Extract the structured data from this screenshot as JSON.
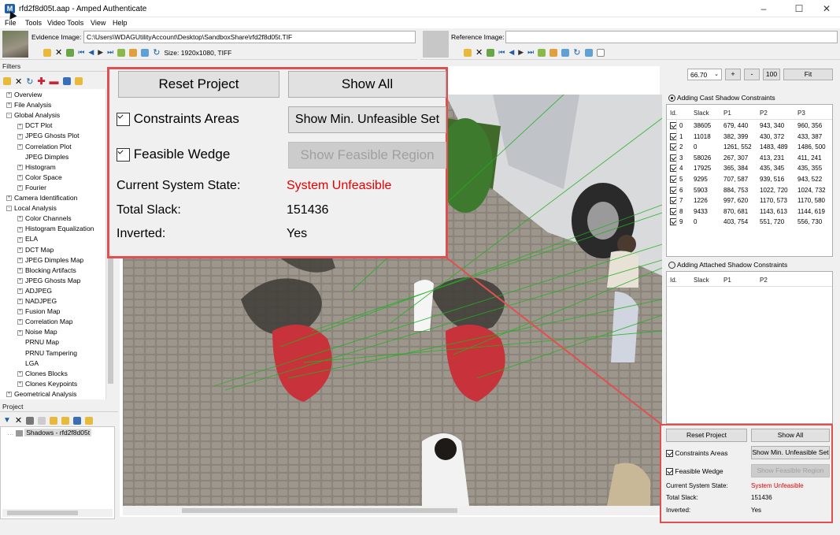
{
  "window": {
    "title": "rfd2f8d05t.aap - Amped Authenticate"
  },
  "menu": [
    "File",
    "Tools",
    "Video Tools",
    "View",
    "Help"
  ],
  "evidence": {
    "label": "Evidence Image:",
    "path": "C:\\Users\\WDAGUtilityAccount\\Desktop\\SandboxShare\\rfd2f8d05t.TIF",
    "size": "Size: 1920x1080, TIFF"
  },
  "reference": {
    "label": "Reference Image:",
    "path": ""
  },
  "filters": {
    "title": "Filters",
    "items": [
      {
        "label": "Overview",
        "level": 1,
        "exp": "+"
      },
      {
        "label": "File Analysis",
        "level": 1,
        "exp": "+"
      },
      {
        "label": "Global Analysis",
        "level": 1,
        "exp": "-"
      },
      {
        "label": "DCT Plot",
        "level": 2,
        "exp": "+"
      },
      {
        "label": "JPEG Ghosts Plot",
        "level": 2,
        "exp": "+"
      },
      {
        "label": "Correlation Plot",
        "level": 2,
        "exp": "+"
      },
      {
        "label": "JPEG Dimples",
        "level": 2,
        "exp": ""
      },
      {
        "label": "Histogram",
        "level": 2,
        "exp": "+"
      },
      {
        "label": "Color Space",
        "level": 2,
        "exp": "+"
      },
      {
        "label": "Fourier",
        "level": 2,
        "exp": "+"
      },
      {
        "label": "Camera Identification",
        "level": 1,
        "exp": "+"
      },
      {
        "label": "Local Analysis",
        "level": 1,
        "exp": "-"
      },
      {
        "label": "Color Channels",
        "level": 2,
        "exp": "+"
      },
      {
        "label": "Histogram Equalization",
        "level": 2,
        "exp": "+"
      },
      {
        "label": "ELA",
        "level": 2,
        "exp": "+"
      },
      {
        "label": "DCT Map",
        "level": 2,
        "exp": "+"
      },
      {
        "label": "JPEG Dimples Map",
        "level": 2,
        "exp": "+"
      },
      {
        "label": "Blocking Artifacts",
        "level": 2,
        "exp": "+"
      },
      {
        "label": "JPEG Ghosts Map",
        "level": 2,
        "exp": "+"
      },
      {
        "label": "ADJPEG",
        "level": 2,
        "exp": "+"
      },
      {
        "label": "NADJPEG",
        "level": 2,
        "exp": "+"
      },
      {
        "label": "Fusion Map",
        "level": 2,
        "exp": "+"
      },
      {
        "label": "Correlation Map",
        "level": 2,
        "exp": "+"
      },
      {
        "label": "Noise Map",
        "level": 2,
        "exp": "+"
      },
      {
        "label": "PRNU Map",
        "level": 2,
        "exp": ""
      },
      {
        "label": "PRNU Tampering",
        "level": 2,
        "exp": ""
      },
      {
        "label": "LGA",
        "level": 2,
        "exp": ""
      },
      {
        "label": "Clones Blocks",
        "level": 2,
        "exp": "+"
      },
      {
        "label": "Clones Keypoints",
        "level": 2,
        "exp": "+"
      },
      {
        "label": "Geometrical Analysis",
        "level": 1,
        "exp": "+"
      }
    ]
  },
  "project": {
    "title": "Project",
    "item": "Shadows - rfd2f8d05t"
  },
  "zoom": {
    "value": "66.70",
    "plus": "+",
    "minus": "-",
    "hundred": "100",
    "fit": "Fit"
  },
  "cast": {
    "title": "Adding Cast Shadow Constraints",
    "headers": [
      "Id.",
      "Slack",
      "P1",
      "P2",
      "P3"
    ],
    "rows": [
      [
        "0",
        "38605",
        "679, 440",
        "943, 340",
        "960, 356"
      ],
      [
        "1",
        "11018",
        "382, 399",
        "430, 372",
        "433, 387"
      ],
      [
        "2",
        "0",
        "1261, 552",
        "1483, 489",
        "1486, 500"
      ],
      [
        "3",
        "58026",
        "267, 307",
        "413, 231",
        "411, 241"
      ],
      [
        "4",
        "17925",
        "365, 384",
        "435, 345",
        "435, 355"
      ],
      [
        "5",
        "9295",
        "707, 587",
        "939, 516",
        "943, 522"
      ],
      [
        "6",
        "5903",
        "884, 753",
        "1022, 720",
        "1024, 732"
      ],
      [
        "7",
        "1226",
        "997, 620",
        "1170, 573",
        "1170, 580"
      ],
      [
        "8",
        "9433",
        "870, 681",
        "1143, 613",
        "1144, 619"
      ],
      [
        "9",
        "0",
        "403, 754",
        "551, 720",
        "556, 730"
      ]
    ]
  },
  "attached": {
    "title": "Adding Attached Shadow Constraints",
    "headers": [
      "Id.",
      "Slack",
      "P1",
      "P2"
    ]
  },
  "controls": {
    "reset": "Reset Project",
    "show_all": "Show All",
    "constraints_areas": "Constraints Areas",
    "show_min": "Show Min. Unfeasible Set",
    "feasible_wedge": "Feasible Wedge",
    "show_region": "Show Feasible Region",
    "state_label": "Current System State:",
    "state_value": "System Unfeasible",
    "slack_label": "Total Slack:",
    "slack_value": "151436",
    "inverted_label": "Inverted:",
    "inverted_value": "Yes"
  },
  "colors": {
    "accent": "#e60000",
    "callout": "#e05050",
    "shadow_line": "#1fb21f"
  }
}
